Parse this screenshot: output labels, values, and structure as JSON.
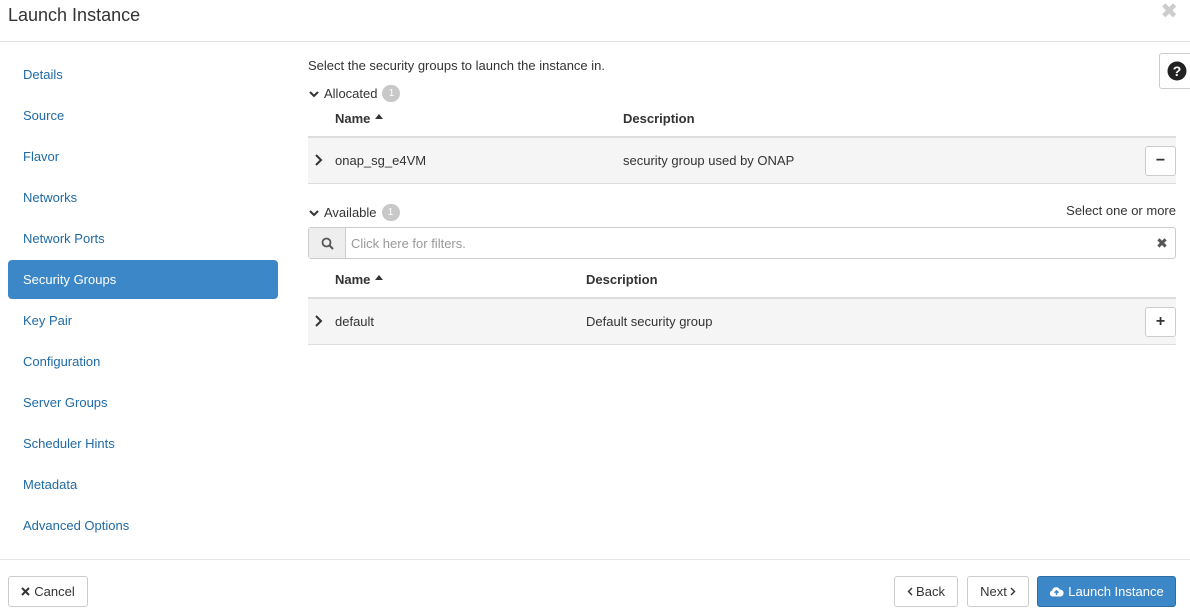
{
  "modal": {
    "title": "Launch Instance",
    "close_glyph": "✖"
  },
  "sidebar": {
    "items": [
      {
        "label": "Details"
      },
      {
        "label": "Source"
      },
      {
        "label": "Flavor"
      },
      {
        "label": "Networks"
      },
      {
        "label": "Network Ports"
      },
      {
        "label": "Security Groups",
        "active": true
      },
      {
        "label": "Key Pair"
      },
      {
        "label": "Configuration"
      },
      {
        "label": "Server Groups"
      },
      {
        "label": "Scheduler Hints"
      },
      {
        "label": "Metadata"
      },
      {
        "label": "Advanced Options"
      }
    ]
  },
  "main": {
    "intro": "Select the security groups to launch the instance in.",
    "allocated": {
      "label": "Allocated",
      "count": "1",
      "columns": {
        "name": "Name",
        "description": "Description"
      },
      "rows": [
        {
          "name": "onap_sg_e4VM",
          "description": "security group used by ONAP",
          "action": "−"
        }
      ]
    },
    "available": {
      "label": "Available",
      "count": "1",
      "hint": "Select one or more",
      "filter_placeholder": "Click here for filters.",
      "columns": {
        "name": "Name",
        "description": "Description"
      },
      "rows": [
        {
          "name": "default",
          "description": "Default security group",
          "action": "+"
        }
      ]
    }
  },
  "help": {
    "glyph": "?"
  },
  "footer": {
    "cancel": "Cancel",
    "back": "Back",
    "next": "Next",
    "launch": "Launch Instance"
  },
  "colors": {
    "accent": "#3c87c8",
    "link": "#1f6aa5",
    "badge": "#c8c8c8",
    "row_bg": "#f5f5f5"
  }
}
